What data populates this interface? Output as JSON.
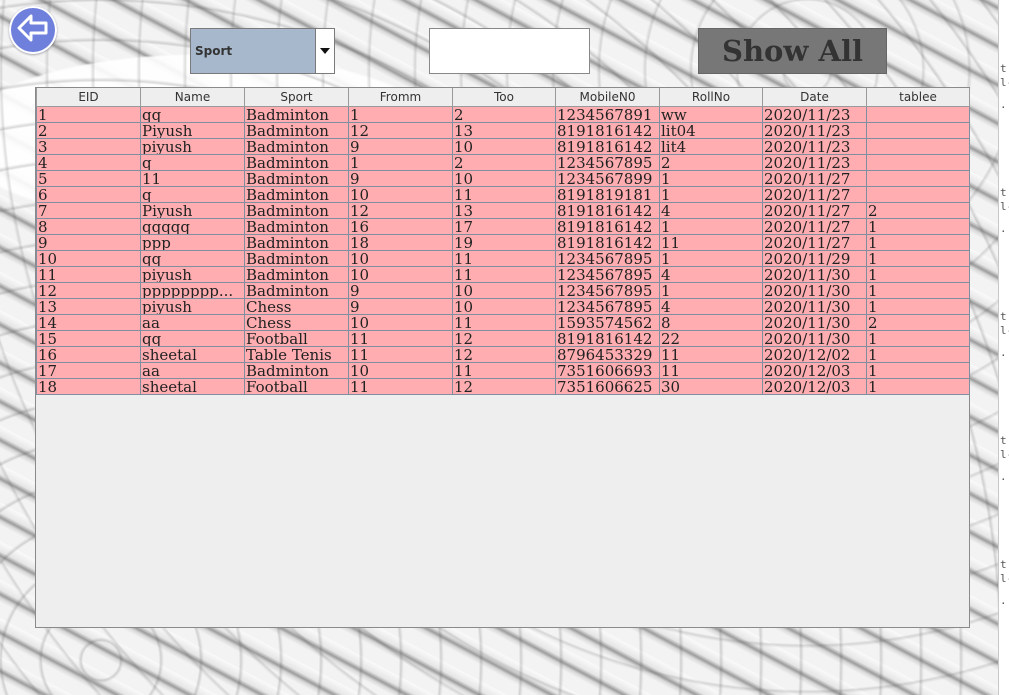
{
  "colors": {
    "back_button": "#6f80dc",
    "combo_background": "#a7b8cc",
    "show_all_button": "#777777",
    "row_background": "#ffadb0",
    "table_background": "#eeeeee"
  },
  "icons": {
    "back": "arrow-left-icon",
    "dropdown": "caret-down-icon"
  },
  "filter": {
    "selected": "Sport",
    "search_value": ""
  },
  "show_all_label": "Show All",
  "table": {
    "columns": [
      "EID",
      "Name",
      "Sport",
      "Fromm",
      "Too",
      "MobileN0",
      "RollNo",
      "Date",
      "tablee"
    ],
    "rows": [
      [
        "1",
        "qq",
        "Badminton",
        "1",
        "2",
        "1234567891",
        "ww",
        "2020/11/23",
        ""
      ],
      [
        "2",
        "Piyush",
        "Badminton",
        "12",
        "13",
        "8191816142",
        "lit04",
        "2020/11/23",
        ""
      ],
      [
        "3",
        "piyush",
        "Badminton",
        "9",
        "10",
        "8191816142",
        "lit4",
        "2020/11/23",
        ""
      ],
      [
        "4",
        "q",
        "Badminton",
        "1",
        "2",
        "1234567895",
        "2",
        "2020/11/23",
        ""
      ],
      [
        "5",
        "11",
        "Badminton",
        "9",
        "10",
        "1234567899",
        "1",
        "2020/11/27",
        ""
      ],
      [
        "6",
        "q",
        "Badminton",
        "10",
        "11",
        "8191819181",
        "1",
        "2020/11/27",
        ""
      ],
      [
        "7",
        "Piyush",
        "Badminton",
        "12",
        "13",
        "8191816142",
        "4",
        "2020/11/27",
        "2"
      ],
      [
        "8",
        "qqqqq",
        "Badminton",
        "16",
        "17",
        "8191816142",
        "1",
        "2020/11/27",
        "1"
      ],
      [
        "9",
        "ppp",
        "Badminton",
        "18",
        "19",
        "8191816142",
        "11",
        "2020/11/27",
        "1"
      ],
      [
        "10",
        "qq",
        "Badminton",
        "10",
        "11",
        "1234567895",
        "1",
        "2020/11/29",
        "1"
      ],
      [
        "11",
        "piyush",
        "Badminton",
        "10",
        "11",
        "1234567895",
        "4",
        "2020/11/30",
        "1"
      ],
      [
        "12",
        "pppppppp...",
        "Badminton",
        "9",
        "10",
        "1234567895",
        "1",
        "2020/11/30",
        "1"
      ],
      [
        "13",
        "piyush",
        "Chess",
        "9",
        "10",
        "1234567895",
        "4",
        "2020/11/30",
        "1"
      ],
      [
        "14",
        "aa",
        "Chess",
        "10",
        "11",
        "1593574562",
        "8",
        "2020/11/30",
        "2"
      ],
      [
        "15",
        "qq",
        "Football",
        "11",
        "12",
        "8191816142",
        "22",
        "2020/11/30",
        "1"
      ],
      [
        "16",
        "sheetal",
        "Table Tenis",
        "11",
        "12",
        "8796453329",
        "11",
        "2020/12/02",
        "1"
      ],
      [
        "17",
        "aa",
        "Badminton",
        "10",
        "11",
        "7351606693",
        "11",
        "2020/12/03",
        "1"
      ],
      [
        "18",
        "sheetal",
        "Football",
        "11",
        "12",
        "7351606625",
        "30",
        "2020/12/03",
        "1"
      ]
    ]
  },
  "side_strip_glyphs": [
    "t",
    "l-",
    ".",
    "t",
    "l-",
    ".",
    "t",
    "l-",
    ".",
    "t",
    "l-",
    ".",
    "t",
    "l-",
    ".",
    "t",
    "l-",
    "."
  ]
}
